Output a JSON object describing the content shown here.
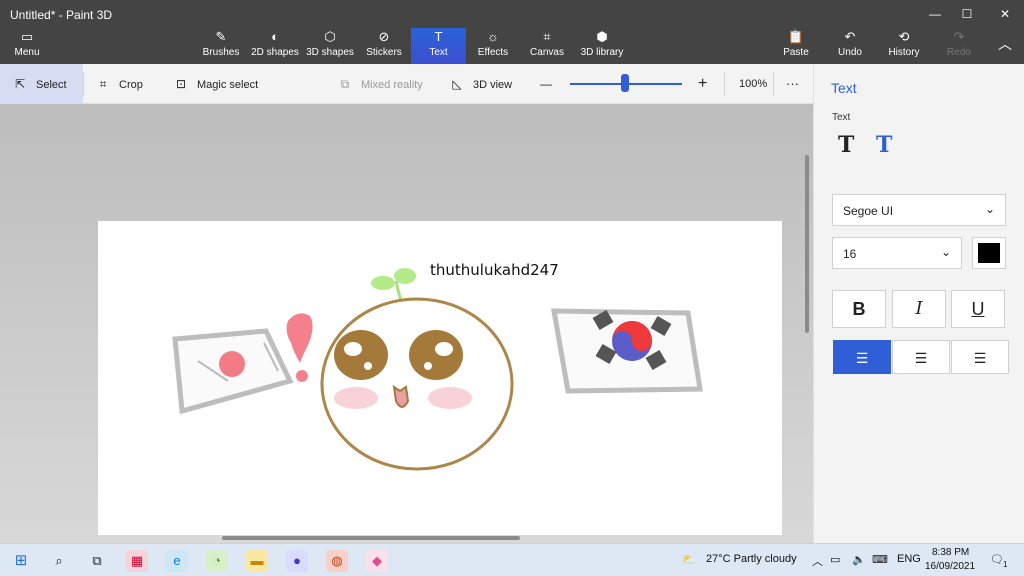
{
  "window": {
    "title": "Untitled* - Paint 3D"
  },
  "window_controls": {
    "minimize": "—",
    "maximize": "☐",
    "close": "✕"
  },
  "ribbon": {
    "menu": {
      "icon": "menu-icon",
      "label": "Menu"
    },
    "tabs": [
      {
        "icon": "brush-icon",
        "label": "Brushes"
      },
      {
        "icon": "2d-shapes-icon",
        "label": "2D shapes"
      },
      {
        "icon": "3d-shapes-icon",
        "label": "3D shapes"
      },
      {
        "icon": "stickers-icon",
        "label": "Stickers"
      },
      {
        "icon": "text-icon",
        "label": "Text",
        "active": true
      },
      {
        "icon": "effects-icon",
        "label": "Effects"
      },
      {
        "icon": "canvas-icon",
        "label": "Canvas"
      },
      {
        "icon": "3d-library-icon",
        "label": "3D library"
      }
    ],
    "right": [
      {
        "icon": "paste-icon",
        "label": "Paste"
      },
      {
        "icon": "undo-icon",
        "label": "Undo"
      },
      {
        "icon": "history-icon",
        "label": "History"
      },
      {
        "icon": "redo-icon",
        "label": "Redo",
        "disabled": true
      }
    ]
  },
  "toolbar": {
    "select": "Select",
    "crop": "Crop",
    "magic_select": "Magic select",
    "mixed_reality": "Mixed reality",
    "view_3d": "3D view",
    "zoom_minus": "—",
    "zoom_plus": "+",
    "zoom_value": "100%",
    "more": "···",
    "zoom_level_fraction": 0.48
  },
  "canvas": {
    "text": "thuthulukahd247"
  },
  "panel": {
    "title": "Text",
    "section": "Text",
    "text_type_icons": [
      "2d-text-icon",
      "3d-text-icon"
    ],
    "font": "Segoe UI",
    "font_size": "16",
    "color": "#000000",
    "format": {
      "bold": "B",
      "italic": "I",
      "underline": "U"
    },
    "alignment": [
      "left",
      "center",
      "right"
    ],
    "accent": "#2f5ed6"
  },
  "taskbar": {
    "weather": "27°C  Partly cloudy",
    "lang": "ENG",
    "time": "8:38 PM",
    "date": "16/09/2021",
    "notif": "1"
  }
}
